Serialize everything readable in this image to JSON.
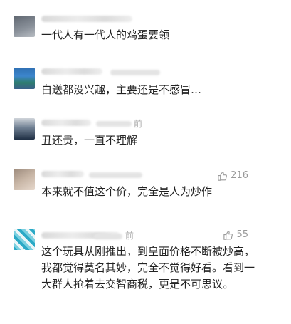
{
  "comments": [
    {
      "time_suffix": "",
      "text": "一代人有一代人的鸡蛋要领",
      "likes": ""
    },
    {
      "time_suffix": "",
      "text": "白送都没兴趣，主要还是不感冒…",
      "likes": ""
    },
    {
      "time_suffix": "前",
      "text": "丑还贵，一直不理解",
      "likes": ""
    },
    {
      "time_suffix": "",
      "text": "本来就不值这个价，完全是人为炒作",
      "likes": "216"
    },
    {
      "time_suffix": "前",
      "text": "这个玩具从刚推出，到皇面价格不断被炒高，我都觉得莫名其妙，完全不觉得好看。看到一大群人抢着去交智商税，更是不可思议。",
      "likes": "55"
    }
  ],
  "icons": {
    "like": "thumbs-up-icon"
  }
}
